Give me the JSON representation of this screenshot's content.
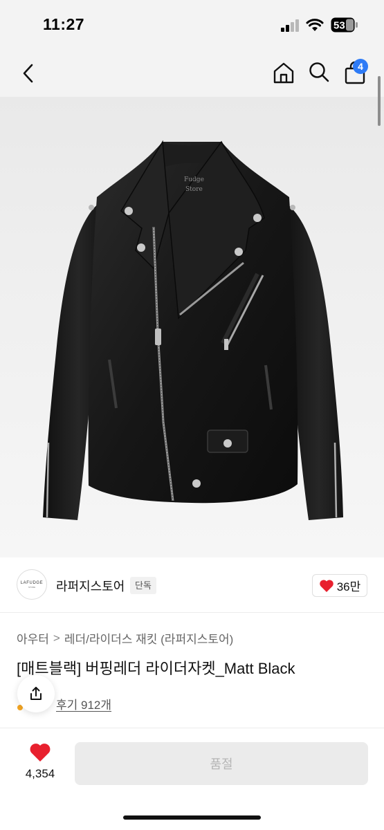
{
  "status_bar": {
    "time": "11:27",
    "battery_level": "53",
    "icons": [
      "signal-icon",
      "wifi-icon",
      "battery-icon"
    ]
  },
  "nav": {
    "icons": [
      "back-icon",
      "home-icon",
      "search-icon",
      "shopping-bag-icon"
    ],
    "cart_count": "4"
  },
  "product_image": {
    "jacket_label_line1": "Fudge",
    "jacket_label_line2": "Store"
  },
  "store": {
    "logo_text": "LAFUDGE",
    "logo_subtext": "STORE",
    "name": "라퍼지스토어",
    "tag": "단독",
    "likes": "36만"
  },
  "product": {
    "breadcrumb": [
      "아우터",
      "레더/라이더스 재킷 (라퍼지스토어)"
    ],
    "breadcrumb_separator": ">",
    "title": "[매트블랙] 버핑레더 라이더자켓_Matt Black",
    "review_link": "후기 912개"
  },
  "bottom_bar": {
    "wish_count": "4,354",
    "soldout_label": "품절"
  },
  "colors": {
    "accent_blue": "#2e7bf6",
    "heart_red": "#e8202e",
    "soldout_bg": "#ebebeb"
  }
}
